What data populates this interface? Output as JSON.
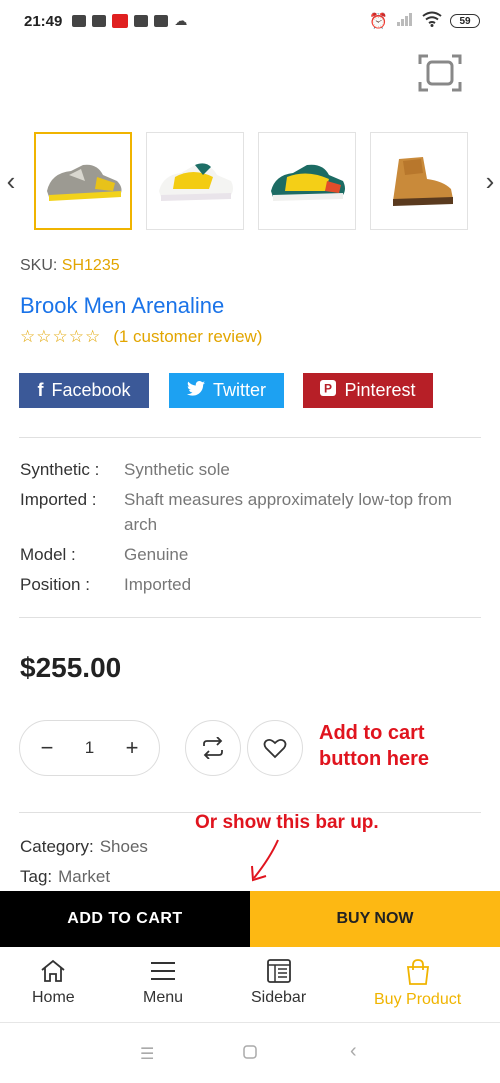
{
  "status_bar": {
    "time": "21:49",
    "battery": "59"
  },
  "product": {
    "sku_label": "SKU:",
    "sku_value": "SH1235",
    "title": "Brook Men Arenaline",
    "stars": "☆☆☆☆☆",
    "review_text": "(1 customer review)",
    "price": "$255.00",
    "quantity": "1"
  },
  "gallery": {
    "prev_icon": "chevron-left",
    "next_icon": "chevron-right",
    "thumbnails": [
      "sneaker-grey-yellow",
      "sneaker-white-yellow",
      "sneaker-teal-yellow",
      "boot-tan"
    ],
    "active_index": 0
  },
  "share": {
    "facebook": "Facebook",
    "twitter": "Twitter",
    "pinterest": "Pinterest",
    "facebook_color": "#3b5998",
    "twitter_color": "#1da1f2",
    "pinterest_color": "#b71f27"
  },
  "specs": [
    {
      "key": "Synthetic :",
      "value": "Synthetic sole"
    },
    {
      "key": "Imported :",
      "value": "Shaft measures approximately low-top from arch"
    },
    {
      "key": "Model :",
      "value": "Genuine"
    },
    {
      "key": "Position :",
      "value": "Imported"
    }
  ],
  "annotations": {
    "add_to_cart_line1": "Add to cart",
    "add_to_cart_line2": "button here",
    "show_bar": "Or show this bar up.",
    "color": "#e0141e"
  },
  "meta": {
    "category_label": "Category:",
    "category_value": "Shoes",
    "tag_label": "Tag:",
    "tag_value": "Market"
  },
  "action_bar": {
    "add_to_cart": "ADD TO CART",
    "buy_now": "BUY NOW",
    "buy_now_color": "#fdb813"
  },
  "tab_bar": {
    "items": [
      {
        "label": "Home",
        "icon": "home-icon"
      },
      {
        "label": "Menu",
        "icon": "menu-icon"
      },
      {
        "label": "Sidebar",
        "icon": "sidebar-icon"
      },
      {
        "label": "Buy Product",
        "icon": "shopping-bag-icon"
      }
    ],
    "active_color": "#f0b400"
  }
}
